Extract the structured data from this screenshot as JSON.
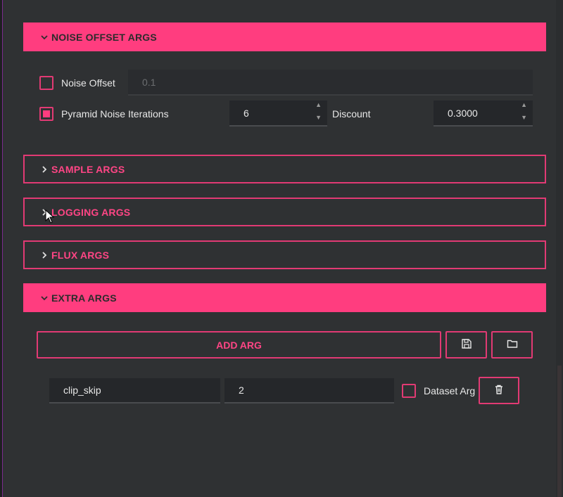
{
  "sections": {
    "noise_offset": {
      "title": "NOISE OFFSET ARGS",
      "expanded": true
    },
    "sample": {
      "title": "SAMPLE ARGS",
      "expanded": false
    },
    "logging": {
      "title": "LOGGING ARGS",
      "expanded": false
    },
    "flux": {
      "title": "FLUX ARGS",
      "expanded": false
    },
    "extra": {
      "title": "EXTRA ARGS",
      "expanded": true
    }
  },
  "noise_offset": {
    "noise_offset_label": "Noise Offset",
    "noise_offset_checked": false,
    "noise_offset_value": "0.1",
    "pyramid_noise_label": "Pyramid Noise",
    "pyramid_noise_checked": true,
    "iterations_label": "Iterations",
    "iterations_value": "6",
    "discount_label": "Discount",
    "discount_value": "0.3000"
  },
  "extra": {
    "add_arg_label": "ADD ARG",
    "save_icon": "save-icon",
    "folder_icon": "folder-icon",
    "args": [
      {
        "name": "clip_skip",
        "value": "2",
        "dataset_arg_label": "Dataset Arg",
        "dataset_arg_checked": false
      }
    ]
  },
  "colors": {
    "accent": "#ff3d7f",
    "background": "#2f3133",
    "field": "#25272a"
  }
}
